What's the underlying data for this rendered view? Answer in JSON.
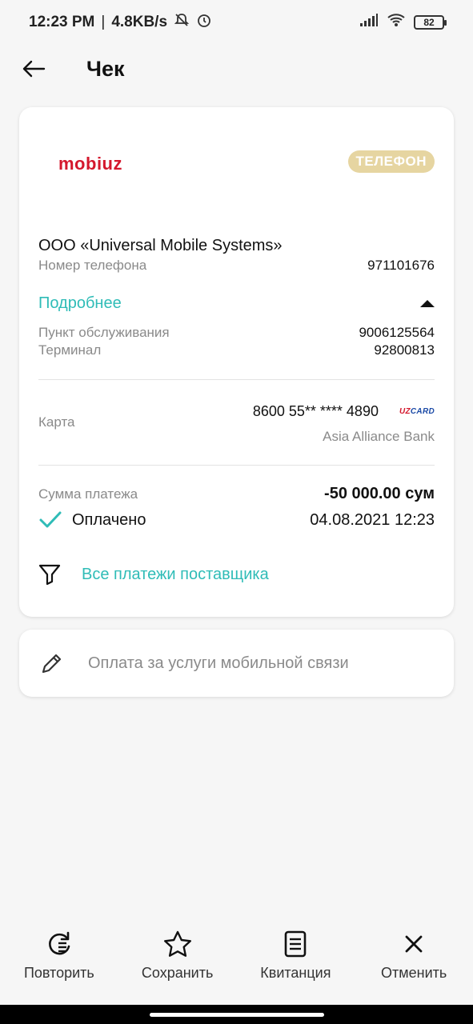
{
  "status": {
    "time": "12:23 PM",
    "speed": "4.8KB/s",
    "battery": "82"
  },
  "header": {
    "title": "Чек"
  },
  "receipt": {
    "logo": "mobiuz",
    "badge": "ТЕЛЕФОН",
    "company": "ООО «Universal Mobile Systems»",
    "phone_label": "Номер телефона",
    "phone_value": "971101676",
    "details_label": "Подробнее",
    "service_point_label": "Пункт обслуживания",
    "service_point_value": "9006125564",
    "terminal_label": "Терминал",
    "terminal_value": "92800813",
    "card_label": "Карта",
    "card_number": "8600 55** **** 4890",
    "card_brand_a": "UZ",
    "card_brand_b": "CARD",
    "bank": "Asia Alliance Bank",
    "amount_label": "Сумма платежа",
    "amount_value": "-50 000.00 сум",
    "paid_label": "Оплачено",
    "datetime": "04.08.2021 12:23",
    "vendor_payments_link": "Все платежи поставщика"
  },
  "note": {
    "text": "Оплата за услуги мобильной связи"
  },
  "actions": [
    {
      "label": "Повторить",
      "icon": "repeat-icon"
    },
    {
      "label": "Сохранить",
      "icon": "star-icon"
    },
    {
      "label": "Квитанция",
      "icon": "receipt-icon"
    },
    {
      "label": "Отменить",
      "icon": "close-icon"
    }
  ],
  "colors": {
    "accent": "#2fbcb7",
    "brand": "#d4182d",
    "badge": "#e6d5a1"
  }
}
